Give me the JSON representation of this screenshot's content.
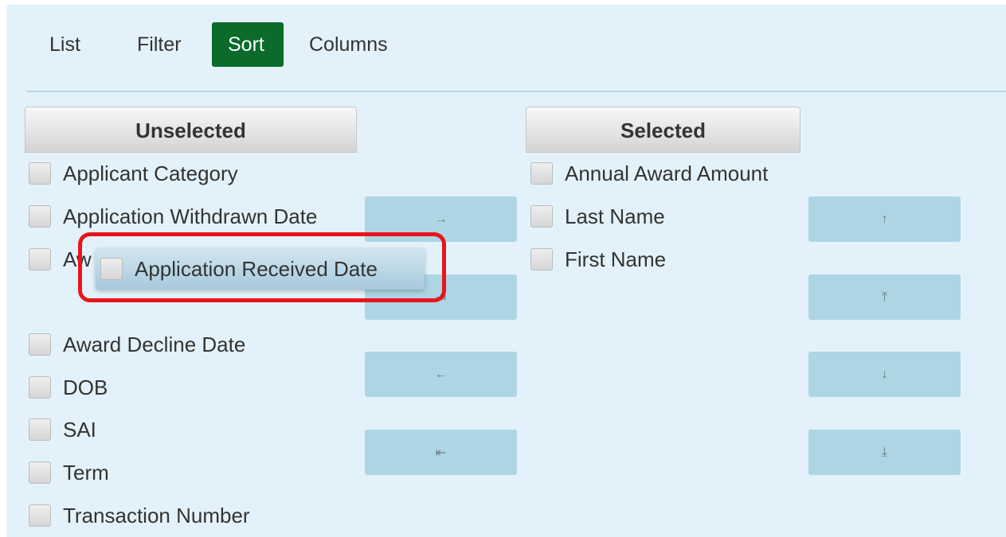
{
  "tabs": {
    "list": "List",
    "filter": "Filter",
    "sort": "Sort",
    "columns": "Columns"
  },
  "unselected": {
    "header": "Unselected",
    "items": [
      "Applicant Category",
      "Application Withdrawn Date",
      "Aw",
      "Award Decline Date",
      "DOB",
      "SAI",
      "Term",
      "Transaction Number"
    ]
  },
  "selected": {
    "header": "Selected",
    "items": [
      "Annual Award Amount",
      "Last Name",
      "First Name"
    ]
  },
  "move_buttons": {
    "add": "→",
    "add_all": "⇥",
    "remove": "←",
    "remove_all": "⇤"
  },
  "order_buttons": {
    "up": "↑",
    "top": "⤒",
    "down": "↓",
    "bottom": "⤓"
  },
  "drag_item": {
    "label": "Application Received Date"
  },
  "colors": {
    "active_tab": "#0a6b2a",
    "panel_bg": "#e3f2fa",
    "button_bg": "#aed5e4",
    "highlight": "#e8141b"
  }
}
